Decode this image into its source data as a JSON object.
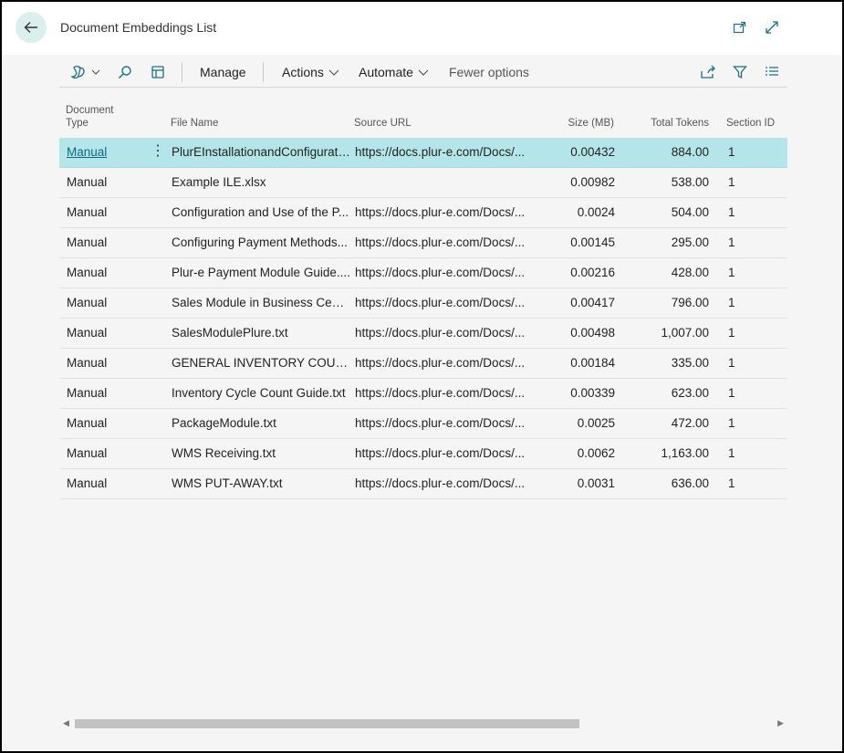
{
  "header": {
    "title": "Document Embeddings List",
    "back_icon": "arrow-left-icon",
    "popout_icon": "open-new-window-icon",
    "expand_icon": "expand-icon"
  },
  "toolbar": {
    "view_icon": "copilot-icon",
    "search_icon": "search-icon",
    "edit_list_icon": "edit-list-icon",
    "manage": "Manage",
    "actions": "Actions",
    "automate": "Automate",
    "fewer_options": "Fewer options",
    "share_icon": "share-icon",
    "filter_icon": "filter-icon",
    "list_view_icon": "list-view-icon"
  },
  "table": {
    "columns": {
      "doc_type_line1": "Document",
      "doc_type_line2": "Type",
      "file_name": "File Name",
      "source_url": "Source URL",
      "size": "Size (MB)",
      "total_tokens": "Total Tokens",
      "section_id": "Section ID"
    },
    "rows": [
      {
        "type": "Manual",
        "file": "PlurEInstallationandConfigurati...",
        "url": "https://docs.plur-e.com/Docs/...",
        "size": "0.00432",
        "tokens": "884.00",
        "section": "1"
      },
      {
        "type": "Manual",
        "file": "Example ILE.xlsx",
        "url": "",
        "size": "0.00982",
        "tokens": "538.00",
        "section": "1"
      },
      {
        "type": "Manual",
        "file": "Configuration and Use of the P...",
        "url": "https://docs.plur-e.com/Docs/...",
        "size": "0.0024",
        "tokens": "504.00",
        "section": "1"
      },
      {
        "type": "Manual",
        "file": "Configuring Payment Methods...",
        "url": "https://docs.plur-e.com/Docs/...",
        "size": "0.00145",
        "tokens": "295.00",
        "section": "1"
      },
      {
        "type": "Manual",
        "file": "Plur-e Payment Module Guide....",
        "url": "https://docs.plur-e.com/Docs/...",
        "size": "0.00216",
        "tokens": "428.00",
        "section": "1"
      },
      {
        "type": "Manual",
        "file": "Sales Module in Business Centr...",
        "url": "https://docs.plur-e.com/Docs/...",
        "size": "0.00417",
        "tokens": "796.00",
        "section": "1"
      },
      {
        "type": "Manual",
        "file": "SalesModulePlure.txt",
        "url": "https://docs.plur-e.com/Docs/...",
        "size": "0.00498",
        "tokens": "1,007.00",
        "section": "1"
      },
      {
        "type": "Manual",
        "file": "GENERAL INVENTORY COUNT ...",
        "url": "https://docs.plur-e.com/Docs/...",
        "size": "0.00184",
        "tokens": "335.00",
        "section": "1"
      },
      {
        "type": "Manual",
        "file": "Inventory Cycle Count Guide.txt",
        "url": "https://docs.plur-e.com/Docs/...",
        "size": "0.00339",
        "tokens": "623.00",
        "section": "1"
      },
      {
        "type": "Manual",
        "file": "PackageModule.txt",
        "url": "https://docs.plur-e.com/Docs/...",
        "size": "0.0025",
        "tokens": "472.00",
        "section": "1"
      },
      {
        "type": "Manual",
        "file": "WMS Receiving.txt",
        "url": "https://docs.plur-e.com/Docs/...",
        "size": "0.0062",
        "tokens": "1,163.00",
        "section": "1"
      },
      {
        "type": "Manual",
        "file": "WMS PUT-AWAY.txt",
        "url": "https://docs.plur-e.com/Docs/...",
        "size": "0.0031",
        "tokens": "636.00",
        "section": "1"
      }
    ],
    "selected_row": 0,
    "row_menu_icon": "more-vertical-icon"
  },
  "scrollbar": {
    "left_icon": "scroll-left-icon",
    "right_icon": "scroll-right-icon",
    "position": 0.0
  },
  "colors": {
    "selection": "#b4e6e9",
    "link": "#0b6a83",
    "accent_circle": "#dcefef"
  }
}
